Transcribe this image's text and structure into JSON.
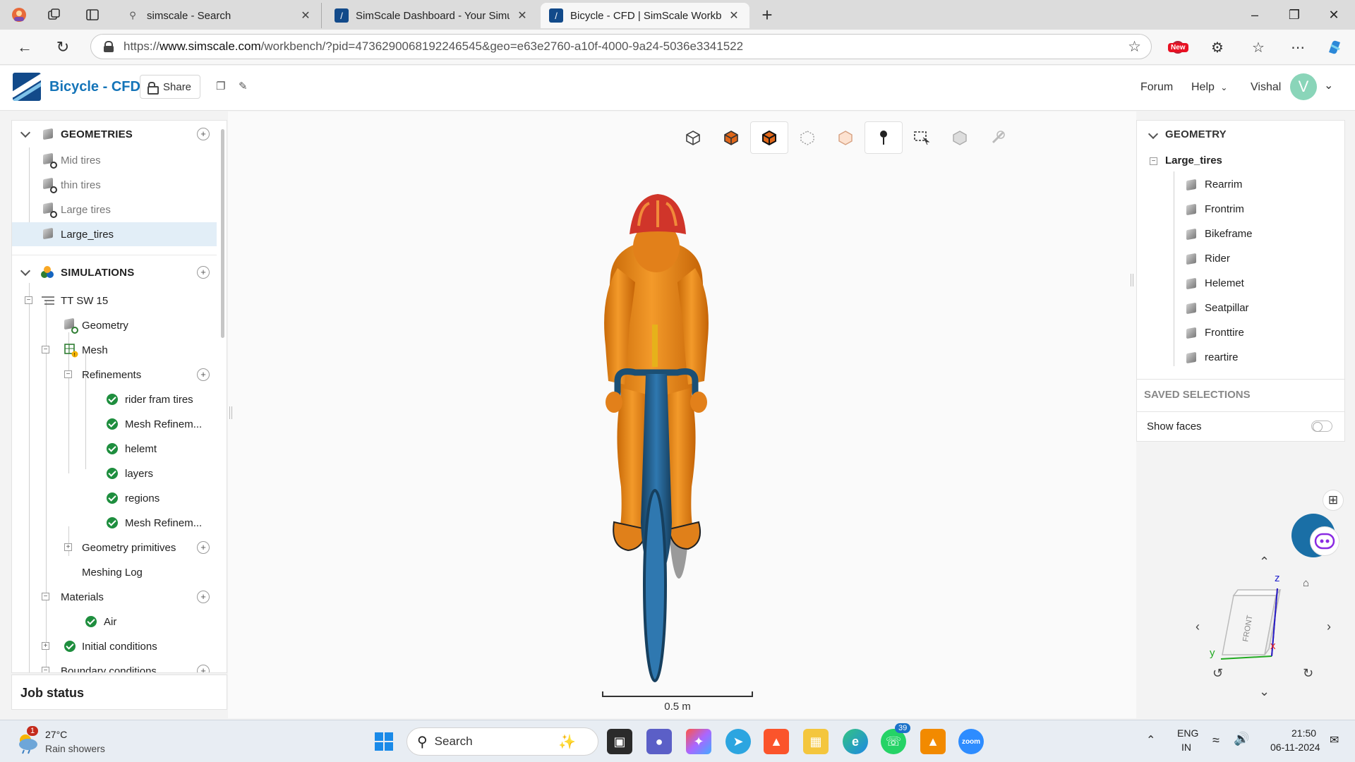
{
  "browser": {
    "tabs": [
      {
        "title": "simscale - Search"
      },
      {
        "title": "SimScale Dashboard - Your Simula"
      },
      {
        "title": "Bicycle - CFD | SimScale Workben"
      }
    ],
    "url_prefix": "https://",
    "url_domain": "www.simscale.com",
    "url_path": "/workbench/?pid=4736290068192246545&geo=e63e2760-a10f-4000-9a24-5036e3341522",
    "new_badge": "New"
  },
  "app": {
    "title": "Bicycle - CFD",
    "share_label": "Share",
    "forum_label": "Forum",
    "help_label": "Help",
    "user_name": "Vishal",
    "avatar_initial": "V"
  },
  "left_panel": {
    "geometries_title": "GEOMETRIES",
    "geometries": [
      "Mid tires",
      "thin tires",
      "Large tires",
      "Large_tires"
    ],
    "simulations_title": "SIMULATIONS",
    "simulation_name": "TT SW 15",
    "geometry_label": "Geometry",
    "mesh_label": "Mesh",
    "refinements_label": "Refinements",
    "refinements": [
      "rider fram tires",
      "Mesh Refinem...",
      "helemt",
      "layers",
      "regions",
      "Mesh Refinem..."
    ],
    "geometry_primitives_label": "Geometry primitives",
    "meshing_log_label": "Meshing Log",
    "materials_label": "Materials",
    "material_air": "Air",
    "initial_conditions_label": "Initial conditions",
    "boundary_conditions_label": "Boundary conditions",
    "job_status_label": "Job status"
  },
  "viewport": {
    "scale_label": "0.5 m"
  },
  "right_panel": {
    "title": "GEOMETRY",
    "assembly": "Large_tires",
    "parts": [
      "Rearrim",
      "Frontrim",
      "Bikeframe",
      "Rider",
      "Helemet",
      "Seatpillar",
      "Fronttire",
      "reartire"
    ],
    "saved_selections": "SAVED SELECTIONS",
    "show_faces": "Show faces",
    "show_faces_on": false
  },
  "navcube": {
    "face_label": "FRONT",
    "axis_x": "x",
    "axis_y": "y",
    "axis_z": "z"
  },
  "taskbar": {
    "weather_temp": "27°C",
    "weather_desc": "Rain showers",
    "weather_badge": "1",
    "search_label": "Search",
    "whatsapp_badge": "39",
    "lang_line1": "ENG",
    "lang_line2": "IN",
    "time": "21:50",
    "date": "06-11-2024"
  },
  "colors": {
    "brand_blue": "#1474b8",
    "selected_row": "#e2eef7",
    "check_green": "#1e8e3e",
    "rider_orange": "#f08a12",
    "helmet_red": "#d0352a",
    "frame_blue": "#1f5f8b"
  }
}
